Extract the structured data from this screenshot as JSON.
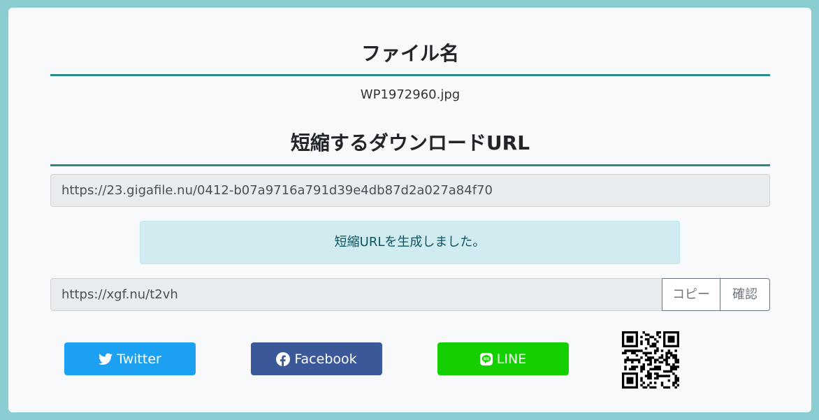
{
  "filename_section": {
    "heading": "ファイル名",
    "filename": "WP1972960.jpg"
  },
  "url_section": {
    "heading": "短縮するダウンロードURL",
    "download_url": "https://23.gigafile.nu/0412-b07a9716a791d39e4db87d2a027a84f70"
  },
  "alert": {
    "message": "短縮URLを生成しました。"
  },
  "short_url": {
    "value": "https://xgf.nu/t2vh",
    "copy_label": "コピー",
    "check_label": "確認"
  },
  "share": {
    "twitter_label": "Twitter",
    "facebook_label": "Facebook",
    "line_label": "LINE",
    "twitter_icon": "twitter-bird-icon",
    "facebook_icon": "facebook-f-icon",
    "line_icon": "line-chat-icon"
  },
  "colors": {
    "accent_rule": "#2e8a8a",
    "twitter": "#1ca0f2",
    "facebook": "#3b5998",
    "line": "#14d000",
    "alert_bg": "#d1ecf1"
  }
}
